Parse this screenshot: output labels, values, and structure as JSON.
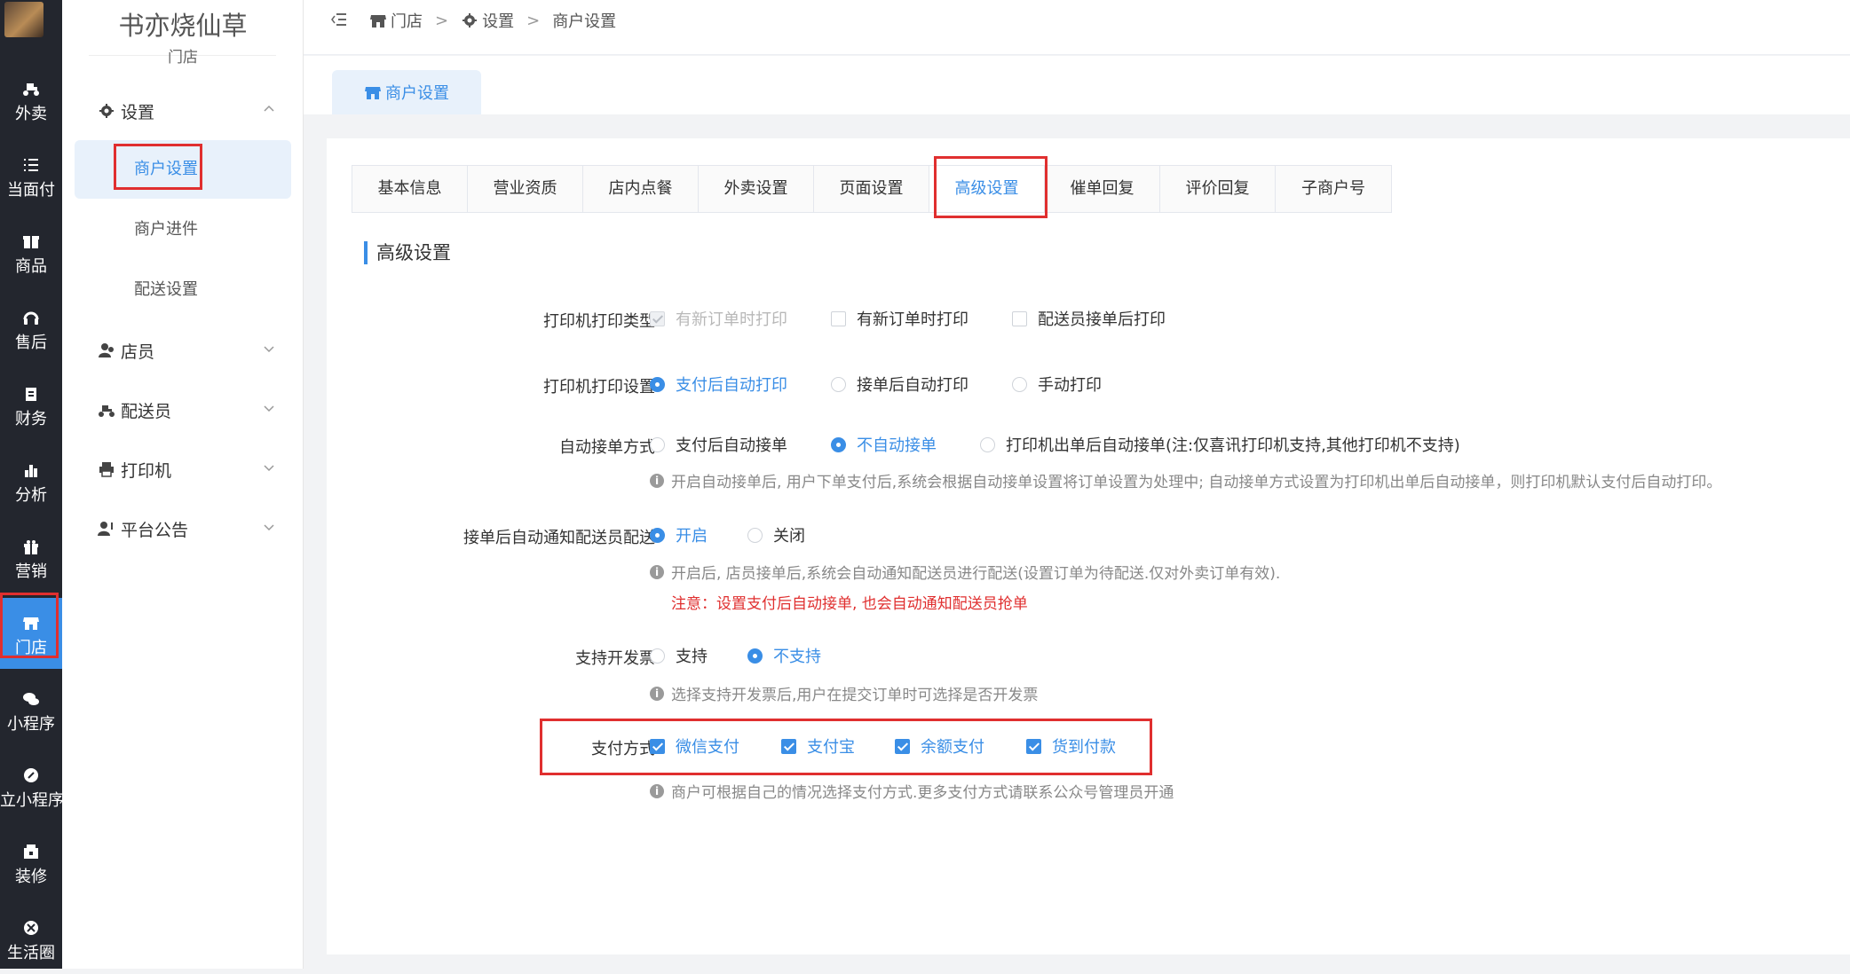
{
  "icon_nav": [
    {
      "label": "外卖",
      "icon": "delivery-scooter-icon"
    },
    {
      "label": "当面付",
      "icon": "list-icon"
    },
    {
      "label": "商品",
      "icon": "goods-icon"
    },
    {
      "label": "售后",
      "icon": "headset-icon"
    },
    {
      "label": "财务",
      "icon": "finance-icon"
    },
    {
      "label": "分析",
      "icon": "bar-chart-icon"
    },
    {
      "label": "营销",
      "icon": "gift-icon"
    },
    {
      "label": "门店",
      "icon": "store-icon",
      "active": true
    },
    {
      "label": "小程序",
      "icon": "wechat-icon"
    },
    {
      "label": "立小程序",
      "icon": "link-icon"
    },
    {
      "label": "装修",
      "icon": "decor-icon"
    },
    {
      "label": "生活圈",
      "icon": "circle-icon"
    }
  ],
  "sidebar": {
    "shop_name": "书亦烧仙草",
    "shop_sub": "门店",
    "groups": [
      {
        "label": "设置",
        "icon": "gear-icon",
        "expanded": true
      },
      {
        "label": "店员",
        "icon": "staff-icon"
      },
      {
        "label": "配送员",
        "icon": "courier-icon"
      },
      {
        "label": "打印机",
        "icon": "printer-icon"
      },
      {
        "label": "平台公告",
        "icon": "announcement-icon"
      }
    ],
    "sub_items": [
      "商户设置",
      "商户进件",
      "配送设置"
    ]
  },
  "breadcrumb": [
    "门店",
    "设置",
    "商户设置"
  ],
  "page_tab": "商户设置",
  "tabs": [
    "基本信息",
    "营业资质",
    "店内点餐",
    "外卖设置",
    "页面设置",
    "高级设置",
    "催单回复",
    "评价回复",
    "子商户号"
  ],
  "active_tab": "高级设置",
  "section_title": "高级设置",
  "form": {
    "print_type": {
      "label": "打印机打印类型",
      "options": [
        "有新订单时打印",
        "有新订单时打印",
        "配送员接单后打印"
      ]
    },
    "print_setting": {
      "label": "打印机打印设置",
      "options": [
        "支付后自动打印",
        "接单后自动打印",
        "手动打印"
      ],
      "selected": "支付后自动打印"
    },
    "auto_accept": {
      "label": "自动接单方式",
      "options": [
        "支付后自动接单",
        "不自动接单",
        "打印机出单后自动接单(注:仅喜讯打印机支持,其他打印机不支持)"
      ],
      "selected": "不自动接单",
      "hint": "开启自动接单后, 用户下单支付后,系统会根据自动接单设置将订单设置为处理中; 自动接单方式设置为打印机出单后自动接单，则打印机默认支付后自动打印。"
    },
    "notify_courier": {
      "label": "接单后自动通知配送员配送",
      "options": [
        "开启",
        "关闭"
      ],
      "selected": "开启",
      "hint": "开启后, 店员接单后,系统会自动通知配送员进行配送(设置订单为待配送.仅对外卖订单有效).",
      "warning": "注意：设置支付后自动接单, 也会自动通知配送员抢单"
    },
    "invoice": {
      "label": "支持开发票",
      "options": [
        "支持",
        "不支持"
      ],
      "selected": "不支持",
      "hint": "选择支持开发票后,用户在提交订单时可选择是否开发票"
    },
    "payment": {
      "label": "支付方式",
      "options": [
        "微信支付",
        "支付宝",
        "余额支付",
        "货到付款"
      ],
      "hint": "商户可根据自己的情况选择支付方式.更多支付方式请联系公众号管理员开通"
    }
  },
  "colors": {
    "accent": "#3a8ee6",
    "sidebar_dark": "#23262e",
    "highlight_red": "#e02f2f"
  }
}
